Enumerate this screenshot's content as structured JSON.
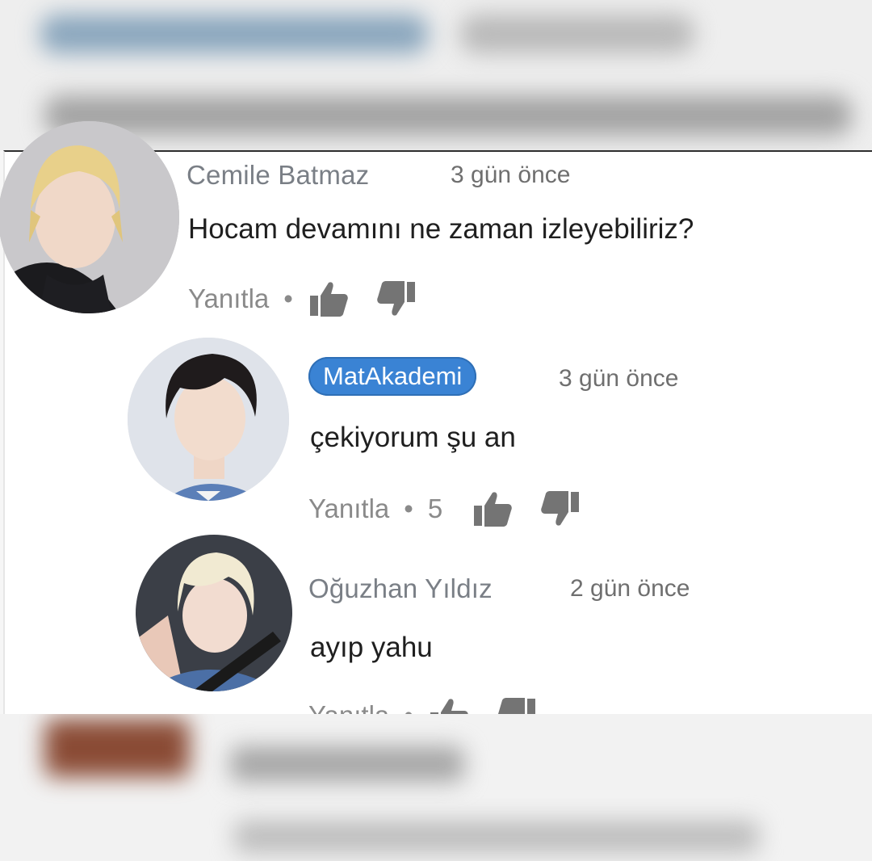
{
  "comments": [
    {
      "author": "Cemile Batmaz",
      "time": "3 gün önce",
      "text": "Hocam devamını ne zaman izleyebiliriz?",
      "reply_label": "Yanıtla",
      "separator": "•",
      "likes": ""
    },
    {
      "author": "MatAkademi",
      "time": "3 gün önce",
      "text": "çekiyorum şu an",
      "reply_label": "Yanıtla",
      "separator": "•",
      "likes": "5",
      "author_badge_color": "#3a83d4"
    },
    {
      "author": "Oğuzhan Yıldız",
      "time": "2 gün önce",
      "text": "ayıp yahu",
      "reply_label": "Yanıtla",
      "separator": "•",
      "likes": ""
    }
  ],
  "icons": {
    "like": "thumbs-up-icon",
    "dislike": "thumbs-down-icon"
  },
  "colors": {
    "author_name": "#7a7f86",
    "creator_badge": "#3a83d4",
    "comment_text": "#1f1f1f",
    "action_gray": "#8a8a8a"
  }
}
